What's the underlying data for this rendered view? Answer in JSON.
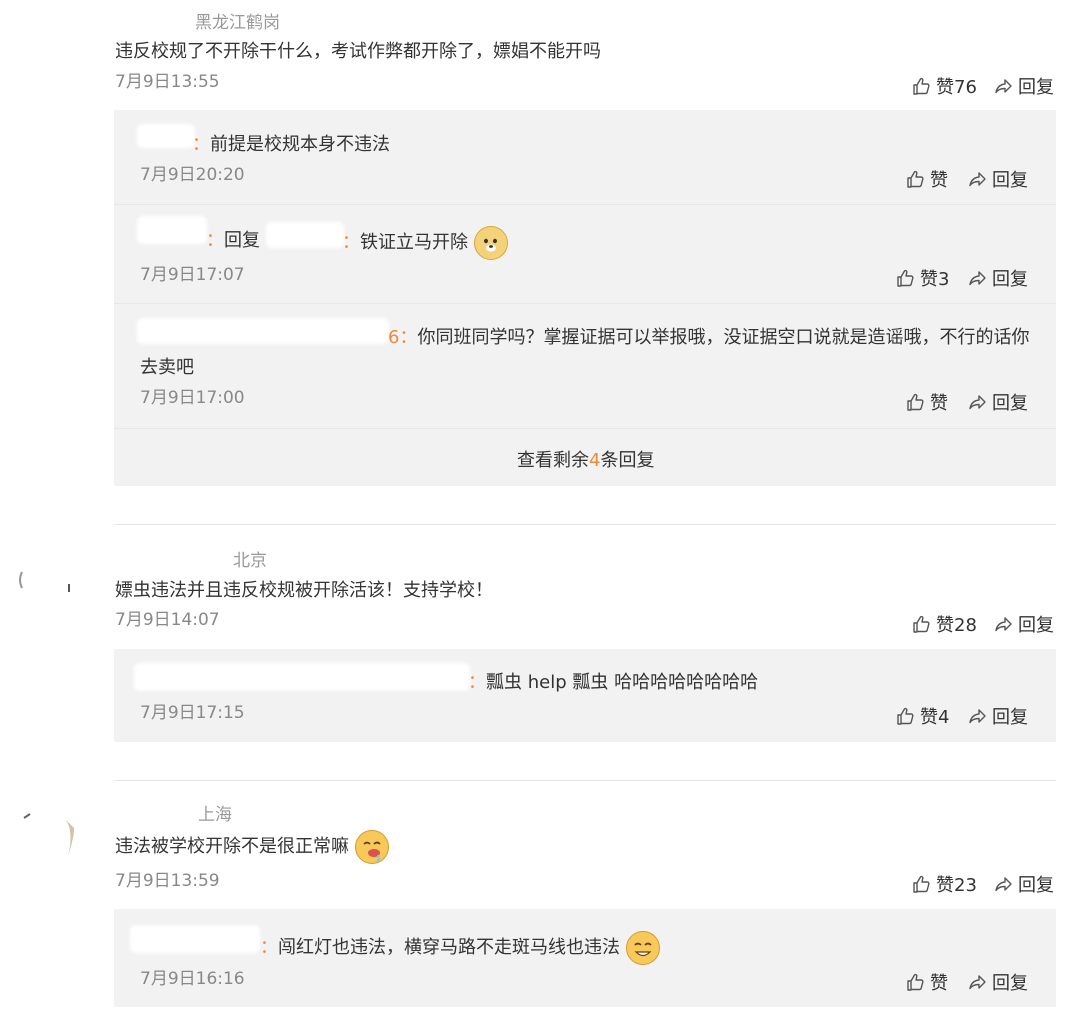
{
  "comments": [
    {
      "location": "黑龙江鹤岗",
      "text": "违反校规了不开除干什么，考试作弊都开除了，嫖娼不能开吗",
      "time": "7月9日13:55",
      "like_label": "赞76",
      "reply_label": "回复",
      "replies": [
        {
          "name_tail": "：",
          "text": "前提是校规本身不违法",
          "time": "7月9日20:20",
          "like_label": "赞",
          "reply_label": "回复"
        },
        {
          "name_tail": "：",
          "reply_word": "回复",
          "target_tail": "：",
          "text": "铁证立马开除",
          "time": "7月9日17:07",
          "like_label": "赞3",
          "reply_label": "回复"
        },
        {
          "name_tail": "6：",
          "text": "你同班同学吗？掌握证据可以举报哦，没证据空口说就是造谣哦，不行的话你",
          "text_line2": "去卖吧",
          "time": "7月9日17:00",
          "like_label": "赞",
          "reply_label": "回复"
        }
      ],
      "more": {
        "prefix": "查看剩余",
        "count": "4",
        "suffix": "条回复"
      }
    },
    {
      "location": "北京",
      "text": "嫖虫违法并且违反校规被开除活该！支持学校！",
      "time": "7月9日14:07",
      "like_label": "赞28",
      "reply_label": "回复",
      "replies": [
        {
          "name_tail": "：",
          "text": "瓢虫 help 瓢虫  哈哈哈哈哈哈哈哈",
          "time": "7月9日17:15",
          "like_label": "赞4",
          "reply_label": "回复"
        }
      ]
    },
    {
      "location": "上海",
      "text": "违法被学校开除不是很正常嘛",
      "time": "7月9日13:59",
      "like_label": "赞23",
      "reply_label": "回复",
      "replies": [
        {
          "name_tail": "：",
          "text": "闯红灯也违法，横穿马路不走斑马线也违法",
          "time": "7月9日16:16",
          "like_label": "赞",
          "reply_label": "回复"
        }
      ]
    }
  ],
  "icons": {
    "like": "thumbs-up-icon",
    "reply": "reply-arrow-icon"
  },
  "colors": {
    "accent": "#ee8a38",
    "panel": "#f2f2f2",
    "meta": "#888888"
  }
}
